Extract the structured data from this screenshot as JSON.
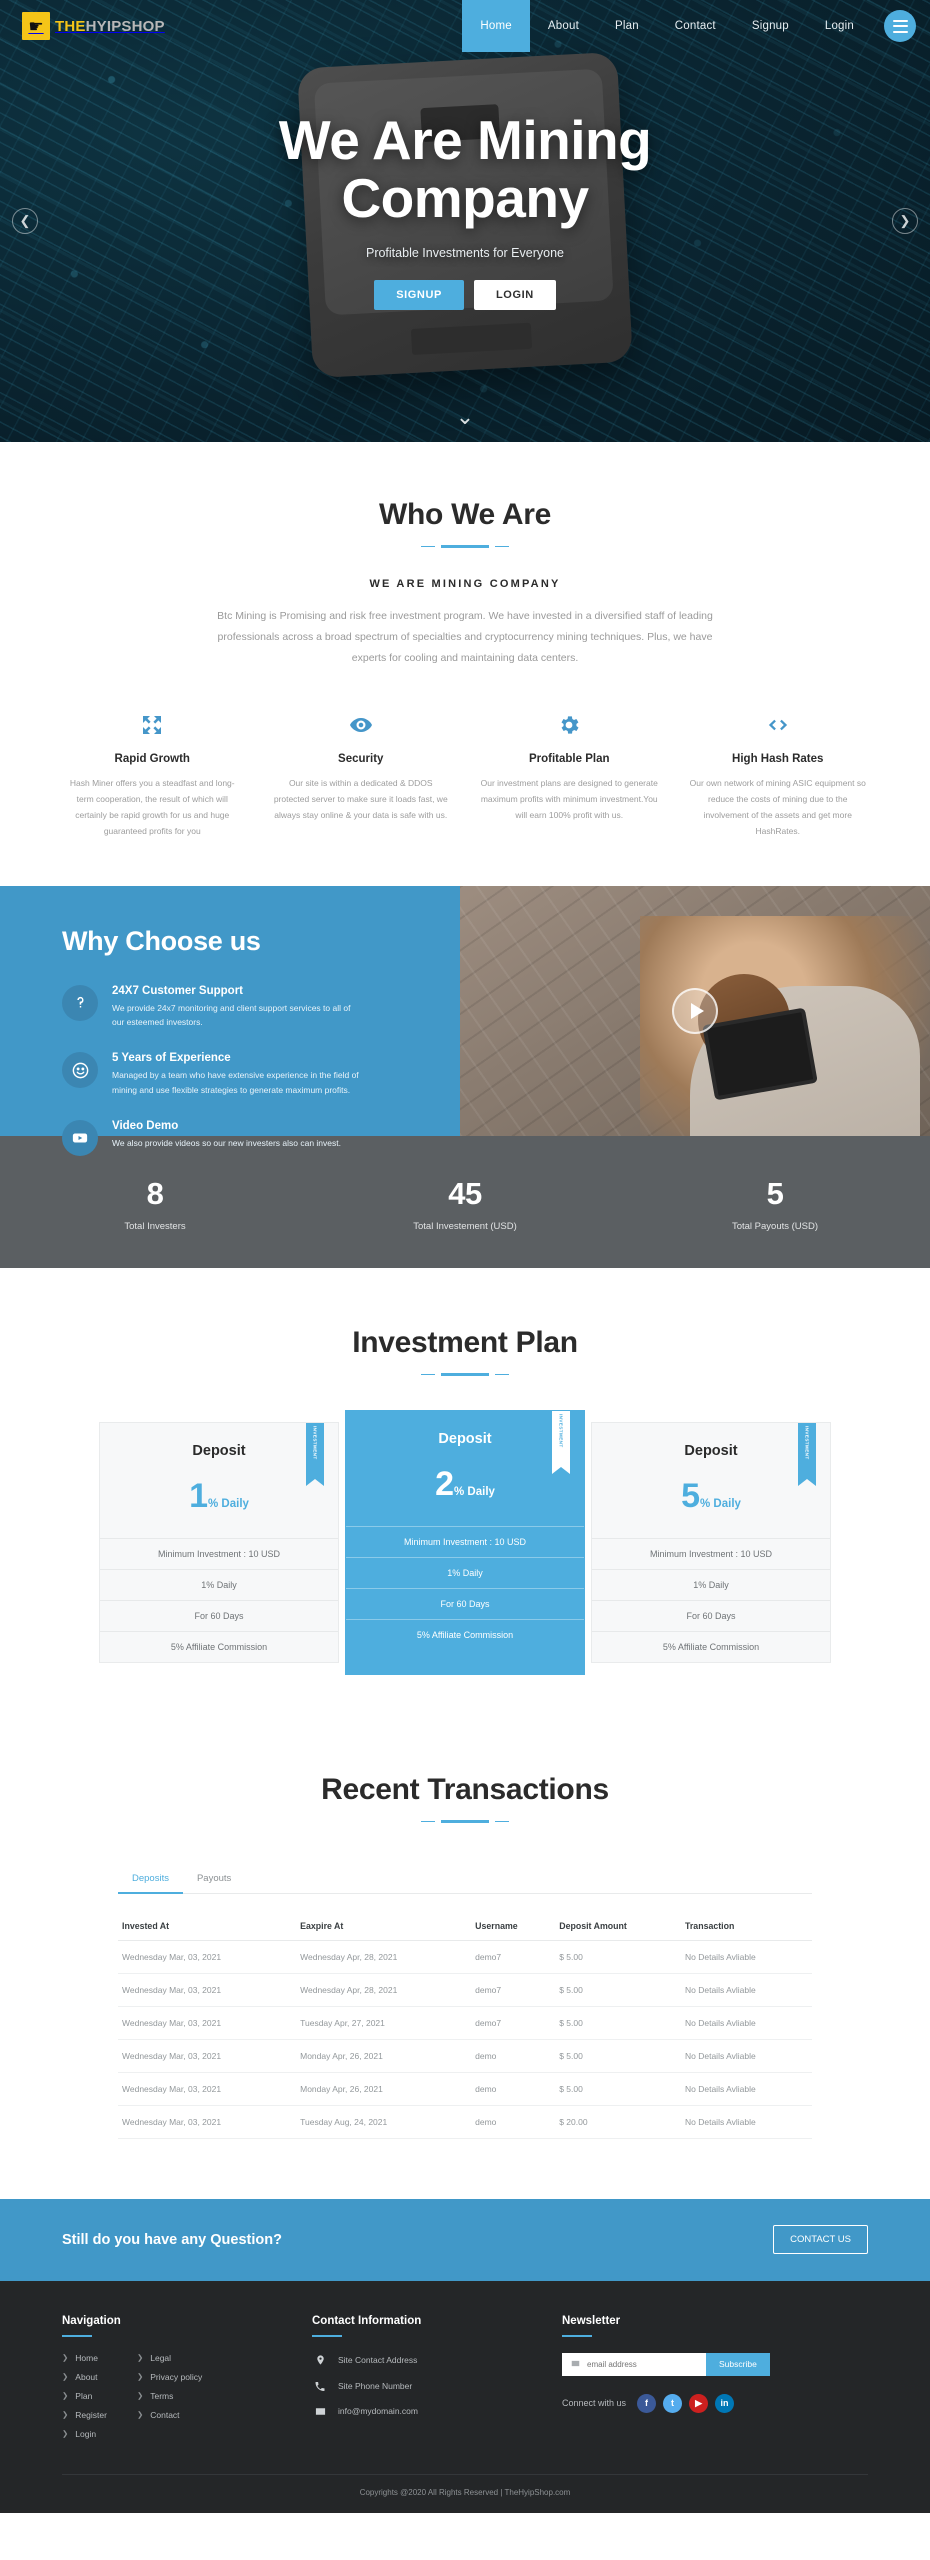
{
  "brand": {
    "mark": "runner-icon",
    "the": "THE",
    "hyip": "HYIP",
    "shop": "SHOP"
  },
  "nav": {
    "items": [
      {
        "label": "Home",
        "active": true
      },
      {
        "label": "About",
        "active": false
      },
      {
        "label": "Plan",
        "active": false
      },
      {
        "label": "Contact",
        "active": false
      },
      {
        "label": "Signup",
        "active": false
      },
      {
        "label": "Login",
        "active": false
      }
    ],
    "menu_icon": "hamburger-icon"
  },
  "hero": {
    "title": "We Are Mining Company",
    "subtitle": "Profitable Investments for Everyone",
    "signup_label": "SIGNUP",
    "login_label": "LOGIN",
    "prev_icon": "chevron-left-icon",
    "next_icon": "chevron-right-icon",
    "scroll_icon": "chevron-down-icon"
  },
  "who": {
    "title": "Who We Are",
    "subtitle": "WE ARE MINING COMPANY",
    "body": "Btc Mining is Promising and risk free investment program. We have invested in a diversified staff of leading professionals across a broad spectrum of specialties and cryptocurrency mining techniques. Plus, we have experts for cooling and maintaining data centers.",
    "features": [
      {
        "icon": "expand-arrows-icon",
        "title": "Rapid Growth",
        "desc": "Hash Miner offers you a steadfast and long-term cooperation, the result of which will certainly be rapid growth for us and huge guaranteed profits for you"
      },
      {
        "icon": "eye-icon",
        "title": "Security",
        "desc": "Our site is within a dedicated & DDOS protected server to make sure it loads fast, we always stay online & your data is safe with us."
      },
      {
        "icon": "gear-icon",
        "title": "Profitable Plan",
        "desc": "Our investment plans are designed to generate maximum profits with minimum investment.You will earn 100% profit with us."
      },
      {
        "icon": "code-icon",
        "title": "High Hash Rates",
        "desc": "Our own network of mining ASIC equipment so reduce the costs of mining due to the involvement of the assets and get more HashRates."
      }
    ]
  },
  "why": {
    "title": "Why Choose us",
    "items": [
      {
        "icon": "question-mark-icon",
        "title": "24X7 Customer Support",
        "desc": "We provide 24x7 monitoring and client support services to all of our esteemed investors."
      },
      {
        "icon": "smiley-face-icon",
        "title": "5 Years of Experience",
        "desc": "Managed by a team who have extensive experience in the field of mining and use flexible strategies to generate maximum profits."
      },
      {
        "icon": "youtube-icon",
        "title": "Video Demo",
        "desc": "We also provide videos so our new investers also can invest."
      }
    ],
    "play_icon": "play-button-icon"
  },
  "stats": [
    {
      "value": "8",
      "label": "Total Investers"
    },
    {
      "value": "45",
      "label": "Total Investement (USD)"
    },
    {
      "value": "5",
      "label": "Total Payouts (USD)"
    }
  ],
  "plans": {
    "title": "Investment Plan",
    "cards": [
      {
        "ribbon": "INVESTMENT",
        "name": "Deposit",
        "rate": "1",
        "unit": "% Daily",
        "rows": [
          "Minimum Investment : 10 USD",
          "1% Daily",
          "For 60 Days",
          "5% Affiliate Commission"
        ],
        "featured": false
      },
      {
        "ribbon": "INVESTMENT",
        "name": "Deposit",
        "rate": "2",
        "unit": "% Daily",
        "rows": [
          "Minimum Investment : 10 USD",
          "1% Daily",
          "For 60 Days",
          "5% Affiliate Commission"
        ],
        "featured": true
      },
      {
        "ribbon": "INVESTMENT",
        "name": "Deposit",
        "rate": "5",
        "unit": "% Daily",
        "rows": [
          "Minimum Investment : 10 USD",
          "1% Daily",
          "For 60 Days",
          "5% Affiliate Commission"
        ],
        "featured": false
      }
    ]
  },
  "transactions": {
    "title": "Recent Transactions",
    "tabs": [
      {
        "label": "Deposits",
        "active": true
      },
      {
        "label": "Payouts",
        "active": false
      }
    ],
    "columns": [
      "Invested At",
      "Eaxpire At",
      "Username",
      "Deposit Amount",
      "Transaction"
    ],
    "rows": [
      [
        "Wednesday Mar, 03, 2021",
        "Wednesday Apr, 28, 2021",
        "demo7",
        "$ 5.00",
        "No Details Avliable"
      ],
      [
        "Wednesday Mar, 03, 2021",
        "Wednesday Apr, 28, 2021",
        "demo7",
        "$ 5.00",
        "No Details Avliable"
      ],
      [
        "Wednesday Mar, 03, 2021",
        "Tuesday Apr, 27, 2021",
        "demo7",
        "$ 5.00",
        "No Details Avliable"
      ],
      [
        "Wednesday Mar, 03, 2021",
        "Monday Apr, 26, 2021",
        "demo",
        "$ 5.00",
        "No Details Avliable"
      ],
      [
        "Wednesday Mar, 03, 2021",
        "Monday Apr, 26, 2021",
        "demo",
        "$ 5.00",
        "No Details Avliable"
      ],
      [
        "Wednesday Mar, 03, 2021",
        "Tuesday Aug, 24, 2021",
        "demo",
        "$ 20.00",
        "No Details Avliable"
      ]
    ]
  },
  "cta": {
    "text": "Still do you have any Question?",
    "button_label": "CONTACT US"
  },
  "footer": {
    "nav_title": "Navigation",
    "nav_col1": [
      "Home",
      "About",
      "Plan",
      "Register",
      "Login"
    ],
    "nav_col2": [
      "Legal",
      "Privacy policy",
      "Terms",
      "Contact"
    ],
    "contact_title": "Contact Information",
    "contact_rows": [
      {
        "icon": "map-pin-icon",
        "text": "Site Contact Address"
      },
      {
        "icon": "phone-icon",
        "text": "Site Phone Number"
      },
      {
        "icon": "envelope-icon",
        "text": "info@mydomain.com"
      }
    ],
    "newsletter_title": "Newsletter",
    "newsletter_placeholder": "email address",
    "newsletter_button": "Subscribe",
    "newsletter_icon": "envelope-icon",
    "connect_label": "Connect with us",
    "socials": [
      {
        "name": "facebook-icon",
        "glyph": "f"
      },
      {
        "name": "twitter-icon",
        "glyph": "t"
      },
      {
        "name": "youtube-icon",
        "glyph": "▶"
      },
      {
        "name": "linkedin-icon",
        "glyph": "in"
      }
    ],
    "copyright": "Copyrights @2020 All Rights Reserved | TheHyipShop.com"
  },
  "colors": {
    "accent": "#4eaede",
    "accent_dark": "#4198c8",
    "dark": "#242628",
    "stat_bg": "#5b5f62"
  }
}
